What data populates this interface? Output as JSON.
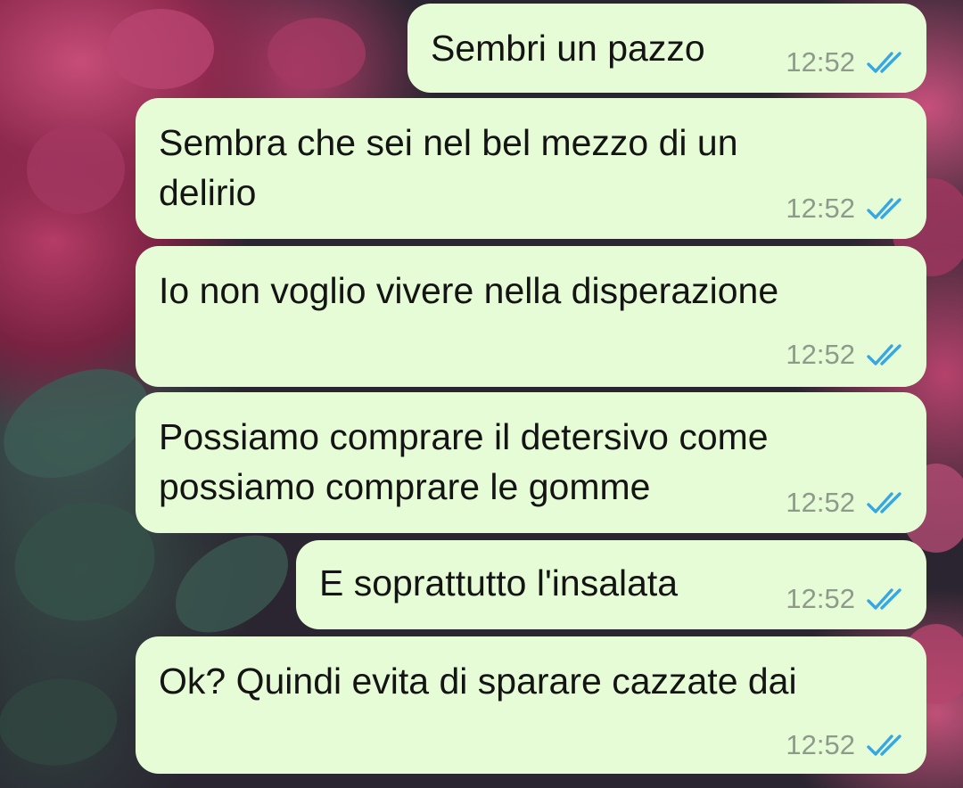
{
  "messages": [
    {
      "text": "Sembri un pazzo",
      "time": "12:52",
      "status": "read-double-check-icon"
    },
    {
      "text": "Sembra che sei nel bel mezzo di un\ndelirio",
      "time": "12:52",
      "status": "read-double-check-icon"
    },
    {
      "text": "Io non voglio vivere nella disperazione",
      "time": "12:52",
      "status": "read-double-check-icon"
    },
    {
      "text": "Possiamo comprare il detersivo come\npossiamo comprare le gomme",
      "time": "12:52",
      "status": "read-double-check-icon"
    },
    {
      "text": "E soprattutto l'insalata",
      "time": "12:52",
      "status": "read-double-check-icon"
    },
    {
      "text": "Ok? Quindi evita di sparare cazzate dai",
      "time": "12:52",
      "status": "read-double-check-icon"
    }
  ],
  "colors": {
    "bubble": "#e6fcd6",
    "text": "#141414",
    "time": "#8e9a8b",
    "read_ticks": "#3aa6e0"
  }
}
